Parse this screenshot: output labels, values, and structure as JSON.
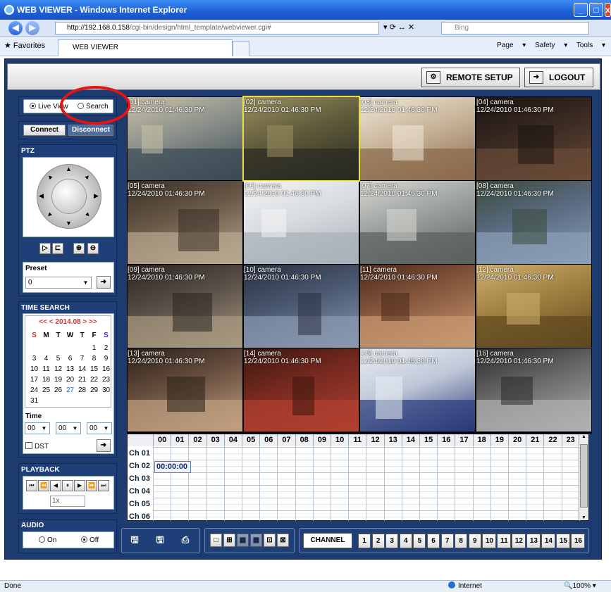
{
  "browser": {
    "title": "WEB VIEWER - Windows Internet Explorer",
    "url_host": "http://192.168.0.158",
    "url_path": "/cgi-bin/design/html_template/webviewer.cgi#",
    "search_placeholder": "Bing",
    "favorites_label": "Favorites",
    "tab_label": "WEB VIEWER",
    "command_bar": "Page ▾  Safety ▾  Tools ▾",
    "status_left": "Done",
    "status_zone": "Internet",
    "status_zoom": "100%"
  },
  "header": {
    "remote_setup": "REMOTE SETUP",
    "logout": "LOGOUT"
  },
  "mode": {
    "live_view": "Live View",
    "search": "Search",
    "selected": "live_view"
  },
  "connection": {
    "connect": "Connect",
    "disconnect": "Disconnect"
  },
  "ptz": {
    "title": "PTZ",
    "preset_label": "Preset",
    "preset_value": "0"
  },
  "time_search": {
    "title": "TIME SEARCH",
    "month": "<< < 2014.08 > >>",
    "weekdays": [
      "S",
      "M",
      "T",
      "W",
      "T",
      "F",
      "S"
    ],
    "weeks": [
      [
        "",
        "",
        "",
        "",
        "",
        "1",
        "2"
      ],
      [
        "3",
        "4",
        "5",
        "6",
        "7",
        "8",
        "9"
      ],
      [
        "10",
        "11",
        "12",
        "13",
        "14",
        "15",
        "16"
      ],
      [
        "17",
        "18",
        "19",
        "20",
        "21",
        "22",
        "23"
      ],
      [
        "24",
        "25",
        "26",
        "27",
        "28",
        "29",
        "30"
      ],
      [
        "31",
        "",
        "",
        "",
        "",
        "",
        ""
      ]
    ],
    "highlight_day": "27",
    "time_label": "Time",
    "hour": "00",
    "minute": "00",
    "second": "00",
    "dst_label": "DST"
  },
  "playback": {
    "title": "PLAYBACK",
    "speed": "1x"
  },
  "audio": {
    "title": "AUDIO",
    "on": "On",
    "off": "Off",
    "selected": "off"
  },
  "cameras": [
    {
      "name": "[01] camera",
      "time": "12/24/2010 01:46:30 PM",
      "colors": [
        "#8a8f8a",
        "#3b4a55",
        "#c9c2a8"
      ]
    },
    {
      "name": "[02] camera",
      "time": "12/24/2010 01:46:30 PM",
      "colors": [
        "#5e5a3a",
        "#2a2a22",
        "#9a9060"
      ]
    },
    {
      "name": "[03] camera",
      "time": "12/24/2010 01:46:30 PM",
      "colors": [
        "#c8b49a",
        "#8a6a4a",
        "#f0e8d8"
      ]
    },
    {
      "name": "[04] camera",
      "time": "12/24/2010 01:46:30 PM",
      "colors": [
        "#3a2a22",
        "#6a4a38",
        "#1a1410"
      ]
    },
    {
      "name": "[05] camera",
      "time": "12/24/2010 01:46:30 PM",
      "colors": [
        "#6a5a48",
        "#b8a890",
        "#3a3028"
      ]
    },
    {
      "name": "[06] camera",
      "time": "12/24/2010 01:46:30 PM",
      "colors": [
        "#d8dce0",
        "#a8b0b8",
        "#f4f4f4"
      ]
    },
    {
      "name": "[07] camera",
      "time": "12/24/2010 01:46:30 PM",
      "colors": [
        "#9aa0a0",
        "#5a6060",
        "#d8d8d0"
      ]
    },
    {
      "name": "[08] camera",
      "time": "12/24/2010 01:46:30 PM",
      "colors": [
        "#5a6a80",
        "#8aa0b8",
        "#3a4a3a"
      ]
    },
    {
      "name": "[09] camera",
      "time": "12/24/2010 01:46:30 PM",
      "colors": [
        "#5a5048",
        "#a89880",
        "#2a2420"
      ]
    },
    {
      "name": "[10] camera",
      "time": "12/24/2010 01:46:30 PM",
      "colors": [
        "#4a5870",
        "#8a98b0",
        "#2a3040"
      ]
    },
    {
      "name": "[11] camera",
      "time": "12/24/2010 01:46:30 PM",
      "colors": [
        "#8a5a40",
        "#c89870",
        "#4a2a1a"
      ]
    },
    {
      "name": "[12] camera",
      "time": "12/24/2010 01:46:30 PM",
      "colors": [
        "#a08040",
        "#604820",
        "#d0b070"
      ]
    },
    {
      "name": "[13] camera",
      "time": "12/24/2010 01:46:30 PM",
      "colors": [
        "#6a5040",
        "#c0a080",
        "#2a2018"
      ]
    },
    {
      "name": "[14] camera",
      "time": "12/24/2010 01:46:30 PM",
      "colors": [
        "#7a2a20",
        "#b04030",
        "#3a1810"
      ]
    },
    {
      "name": "[15] camera",
      "time": "12/24/2010 01:46:30 PM",
      "colors": [
        "#c0c8d8",
        "#2a3a7a",
        "#eaeef4"
      ]
    },
    {
      "name": "[16] camera",
      "time": "12/24/2010 01:46:30 PM",
      "colors": [
        "#6a6a6a",
        "#b0b0b0",
        "#2a2a2a"
      ]
    }
  ],
  "timeline": {
    "hours": [
      "00",
      "01",
      "02",
      "03",
      "04",
      "05",
      "06",
      "07",
      "08",
      "09",
      "10",
      "11",
      "12",
      "13",
      "14",
      "15",
      "16",
      "17",
      "18",
      "19",
      "20",
      "21",
      "22",
      "23"
    ],
    "channels": [
      "Ch 01",
      "Ch 02",
      "Ch 03",
      "Ch 04",
      "Ch 05",
      "Ch 06"
    ],
    "cursor_time": "00:00:00"
  },
  "channel_bar": {
    "label": "CHANNEL",
    "channels": [
      "1",
      "2",
      "3",
      "4",
      "5",
      "6",
      "7",
      "8",
      "9",
      "10",
      "11",
      "12",
      "13",
      "14",
      "15",
      "16"
    ]
  }
}
